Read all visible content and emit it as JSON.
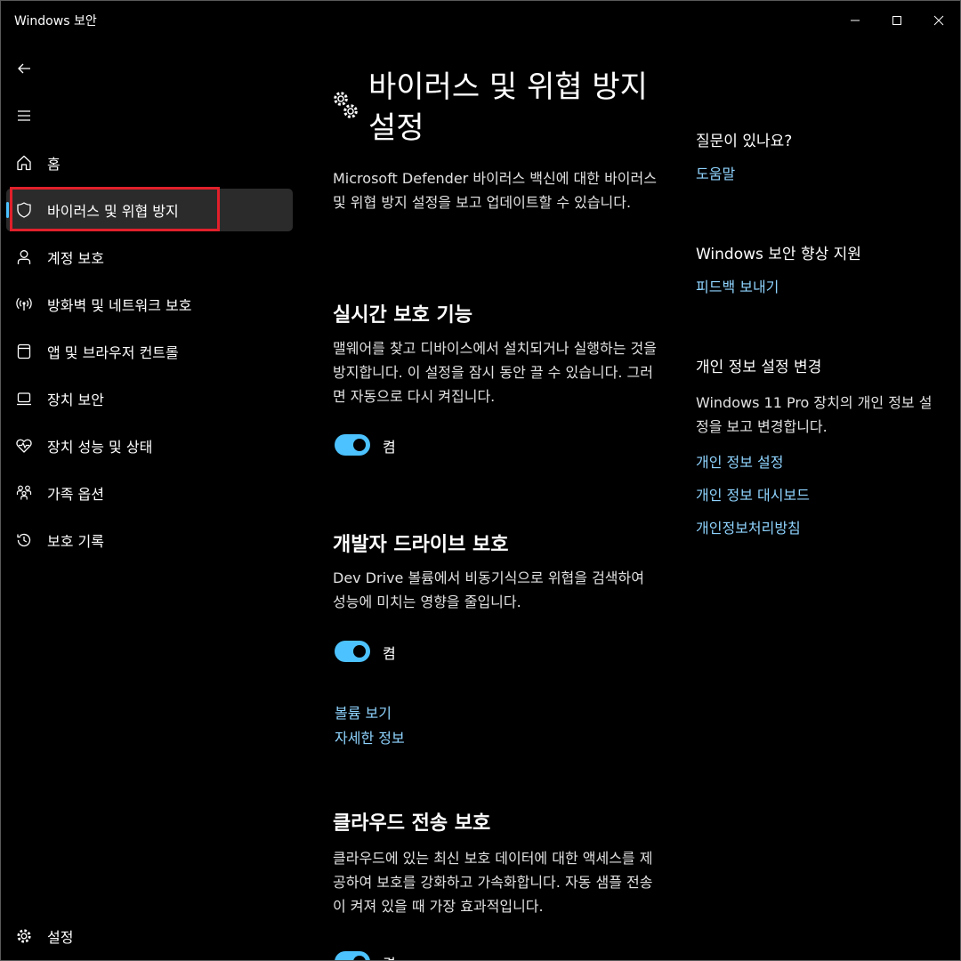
{
  "window": {
    "title": "Windows 보안"
  },
  "sidebar": {
    "items": [
      {
        "label": "홈",
        "icon": "home-icon"
      },
      {
        "label": "바이러스 및 위협 방지",
        "icon": "shield-icon"
      },
      {
        "label": "계정 보호",
        "icon": "person-icon"
      },
      {
        "label": "방화벽 및 네트워크 보호",
        "icon": "antenna-icon"
      },
      {
        "label": "앱 및 브라우저 컨트롤",
        "icon": "app-browser-icon"
      },
      {
        "label": "장치 보안",
        "icon": "laptop-icon"
      },
      {
        "label": "장치 성능 및 상태",
        "icon": "heart-pulse-icon"
      },
      {
        "label": "가족 옵션",
        "icon": "family-icon"
      },
      {
        "label": "보호 기록",
        "icon": "history-icon"
      }
    ],
    "settings_label": "설정"
  },
  "main": {
    "title": "바이러스 및 위협 방지 설정",
    "description": "Microsoft Defender 바이러스 백신에 대한 바이러스 및 위협 방지 설정을 보고 업데이트할 수 있습니다.",
    "sections": {
      "realtime": {
        "title": "실시간 보호 기능",
        "description": "맬웨어를 찾고 디바이스에서 설치되거나 실행하는 것을 방지합니다. 이 설정을 잠시 동안 끌 수 있습니다. 그러면 자동으로 다시 켜집니다.",
        "toggle_label": "켬"
      },
      "devdrive": {
        "title": "개발자 드라이브 보호",
        "description": "Dev Drive 볼륨에서 비동기식으로 위협을 검색하여 성능에 미치는 영향을 줄입니다.",
        "toggle_label": "켬",
        "link_volumes": "볼륨 보기",
        "link_more": "자세한 정보"
      },
      "cloud": {
        "title": "클라우드 전송 보호",
        "description": "클라우드에 있는 최신 보호 데이터에 대한 액세스를 제공하여 보호를 강화하고 가속화합니다. 자동 샘플 전송이 켜져 있을 때 가장 효과적입니다.",
        "toggle_label": "켬"
      }
    }
  },
  "right": {
    "help_heading": "질문이 있나요?",
    "help_link": "도움말",
    "improve_heading": "Windows 보안 향상 지원",
    "feedback_link": "피드백 보내기",
    "privacy_heading": "개인 정보 설정 변경",
    "privacy_desc": "Windows 11 Pro 장치의 개인 정보 설정을 보고 변경합니다.",
    "privacy_links": [
      "개인 정보 설정",
      "개인 정보 대시보드",
      "개인정보처리방침"
    ]
  },
  "colors": {
    "accent": "#4cc2ff",
    "link": "#8fd4ff",
    "highlight_box": "#e0202a",
    "background": "#000000"
  }
}
